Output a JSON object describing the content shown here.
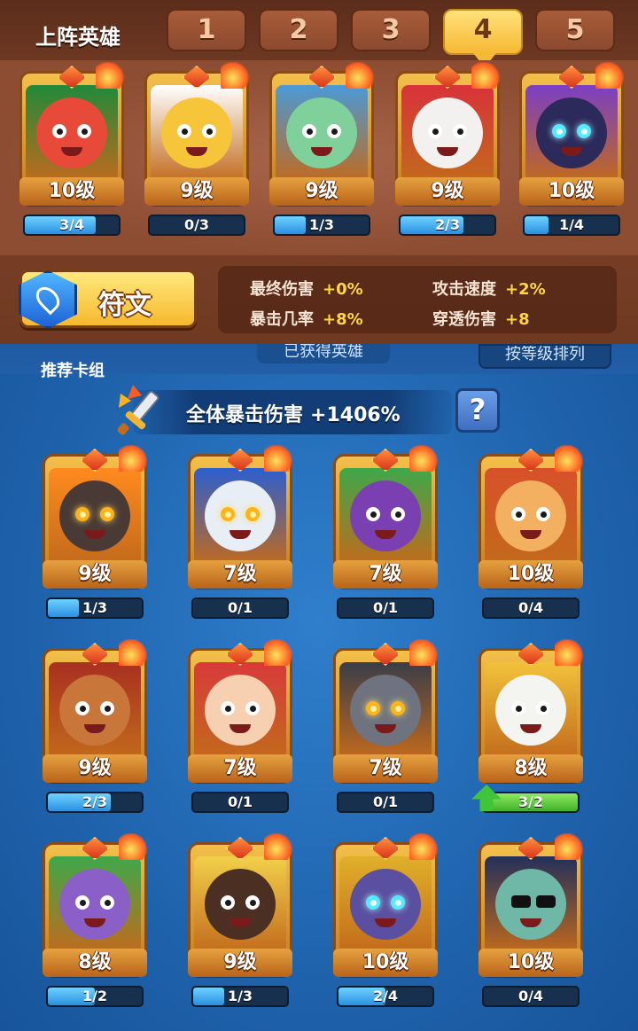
{
  "lineup": {
    "title": "上阵英雄",
    "tabs": [
      "1",
      "2",
      "3",
      "4",
      "5"
    ],
    "active_tab": "4",
    "heroes": [
      {
        "level": "10级",
        "progress": "3/4",
        "fill": 0.75,
        "skin": "#e84a3a",
        "accent": "#1f8a3a",
        "eyes": "normal"
      },
      {
        "level": "9级",
        "progress": "0/3",
        "fill": 0.0,
        "skin": "#f7c53a",
        "accent": "#ffffff",
        "eyes": "normal"
      },
      {
        "level": "9级",
        "progress": "1/3",
        "fill": 0.33,
        "skin": "#7fd09a",
        "accent": "#4a9ad8",
        "eyes": "normal"
      },
      {
        "level": "9级",
        "progress": "2/3",
        "fill": 0.67,
        "skin": "#f3f0f0",
        "accent": "#d8323a",
        "eyes": "normal"
      },
      {
        "level": "10级",
        "progress": "1/4",
        "fill": 0.25,
        "skin": "#2b2a5a",
        "accent": "#7b3fc4",
        "eyes": "cyan"
      }
    ]
  },
  "runes": {
    "button_label": "符文",
    "stats": [
      {
        "label": "最终伤害",
        "value": "+0%"
      },
      {
        "label": "攻击速度",
        "value": "+2%"
      },
      {
        "label": "暴击几率",
        "value": "+8%"
      },
      {
        "label": "穿透伤害",
        "value": "+8"
      }
    ]
  },
  "collection": {
    "recommend_label": "推荐卡组",
    "obtained_label": "已获得英雄",
    "sort_label": "按等级排列",
    "bonus_label": "全体暴击伤害",
    "bonus_value": "+1406%",
    "help_label": "?",
    "heroes": [
      {
        "level": "9级",
        "progress": "1/3",
        "fill": 0.33,
        "skin": "#4a3a36",
        "accent": "#ff8a1f",
        "eyes": "glow"
      },
      {
        "level": "7级",
        "progress": "0/1",
        "fill": 0.0,
        "skin": "#e8eef5",
        "accent": "#2b5fd0",
        "eyes": "glow"
      },
      {
        "level": "7级",
        "progress": "0/1",
        "fill": 0.0,
        "skin": "#7a3fb0",
        "accent": "#3fa84a",
        "eyes": "normal"
      },
      {
        "level": "10级",
        "progress": "0/4",
        "fill": 0.0,
        "skin": "#f2b060",
        "accent": "#d8502a",
        "eyes": "normal"
      },
      {
        "level": "9级",
        "progress": "2/3",
        "fill": 0.67,
        "skin": "#c8763a",
        "accent": "#a83020",
        "eyes": "normal"
      },
      {
        "level": "7级",
        "progress": "0/1",
        "fill": 0.0,
        "skin": "#f6d0b0",
        "accent": "#d83a3a",
        "eyes": "normal"
      },
      {
        "level": "7级",
        "progress": "0/1",
        "fill": 0.0,
        "skin": "#6f7380",
        "accent": "#3a3d48",
        "eyes": "glow"
      },
      {
        "level": "8级",
        "progress": "3/2",
        "fill": 1.0,
        "skin": "#f4f4f0",
        "accent": "#f2c23a",
        "eyes": "normal",
        "upgrade": true
      },
      {
        "level": "8级",
        "progress": "1/2",
        "fill": 0.5,
        "skin": "#8a5fc8",
        "accent": "#3fa84a",
        "eyes": "normal"
      },
      {
        "level": "9级",
        "progress": "1/3",
        "fill": 0.33,
        "skin": "#4a2f22",
        "accent": "#f2d04a",
        "eyes": "normal"
      },
      {
        "level": "10级",
        "progress": "2/4",
        "fill": 0.5,
        "skin": "#5a4fa0",
        "accent": "#e0b02a",
        "eyes": "cyan"
      },
      {
        "level": "10级",
        "progress": "0/4",
        "fill": 0.0,
        "skin": "#6fb8a8",
        "accent": "#23305a",
        "eyes": "glasses"
      }
    ]
  }
}
